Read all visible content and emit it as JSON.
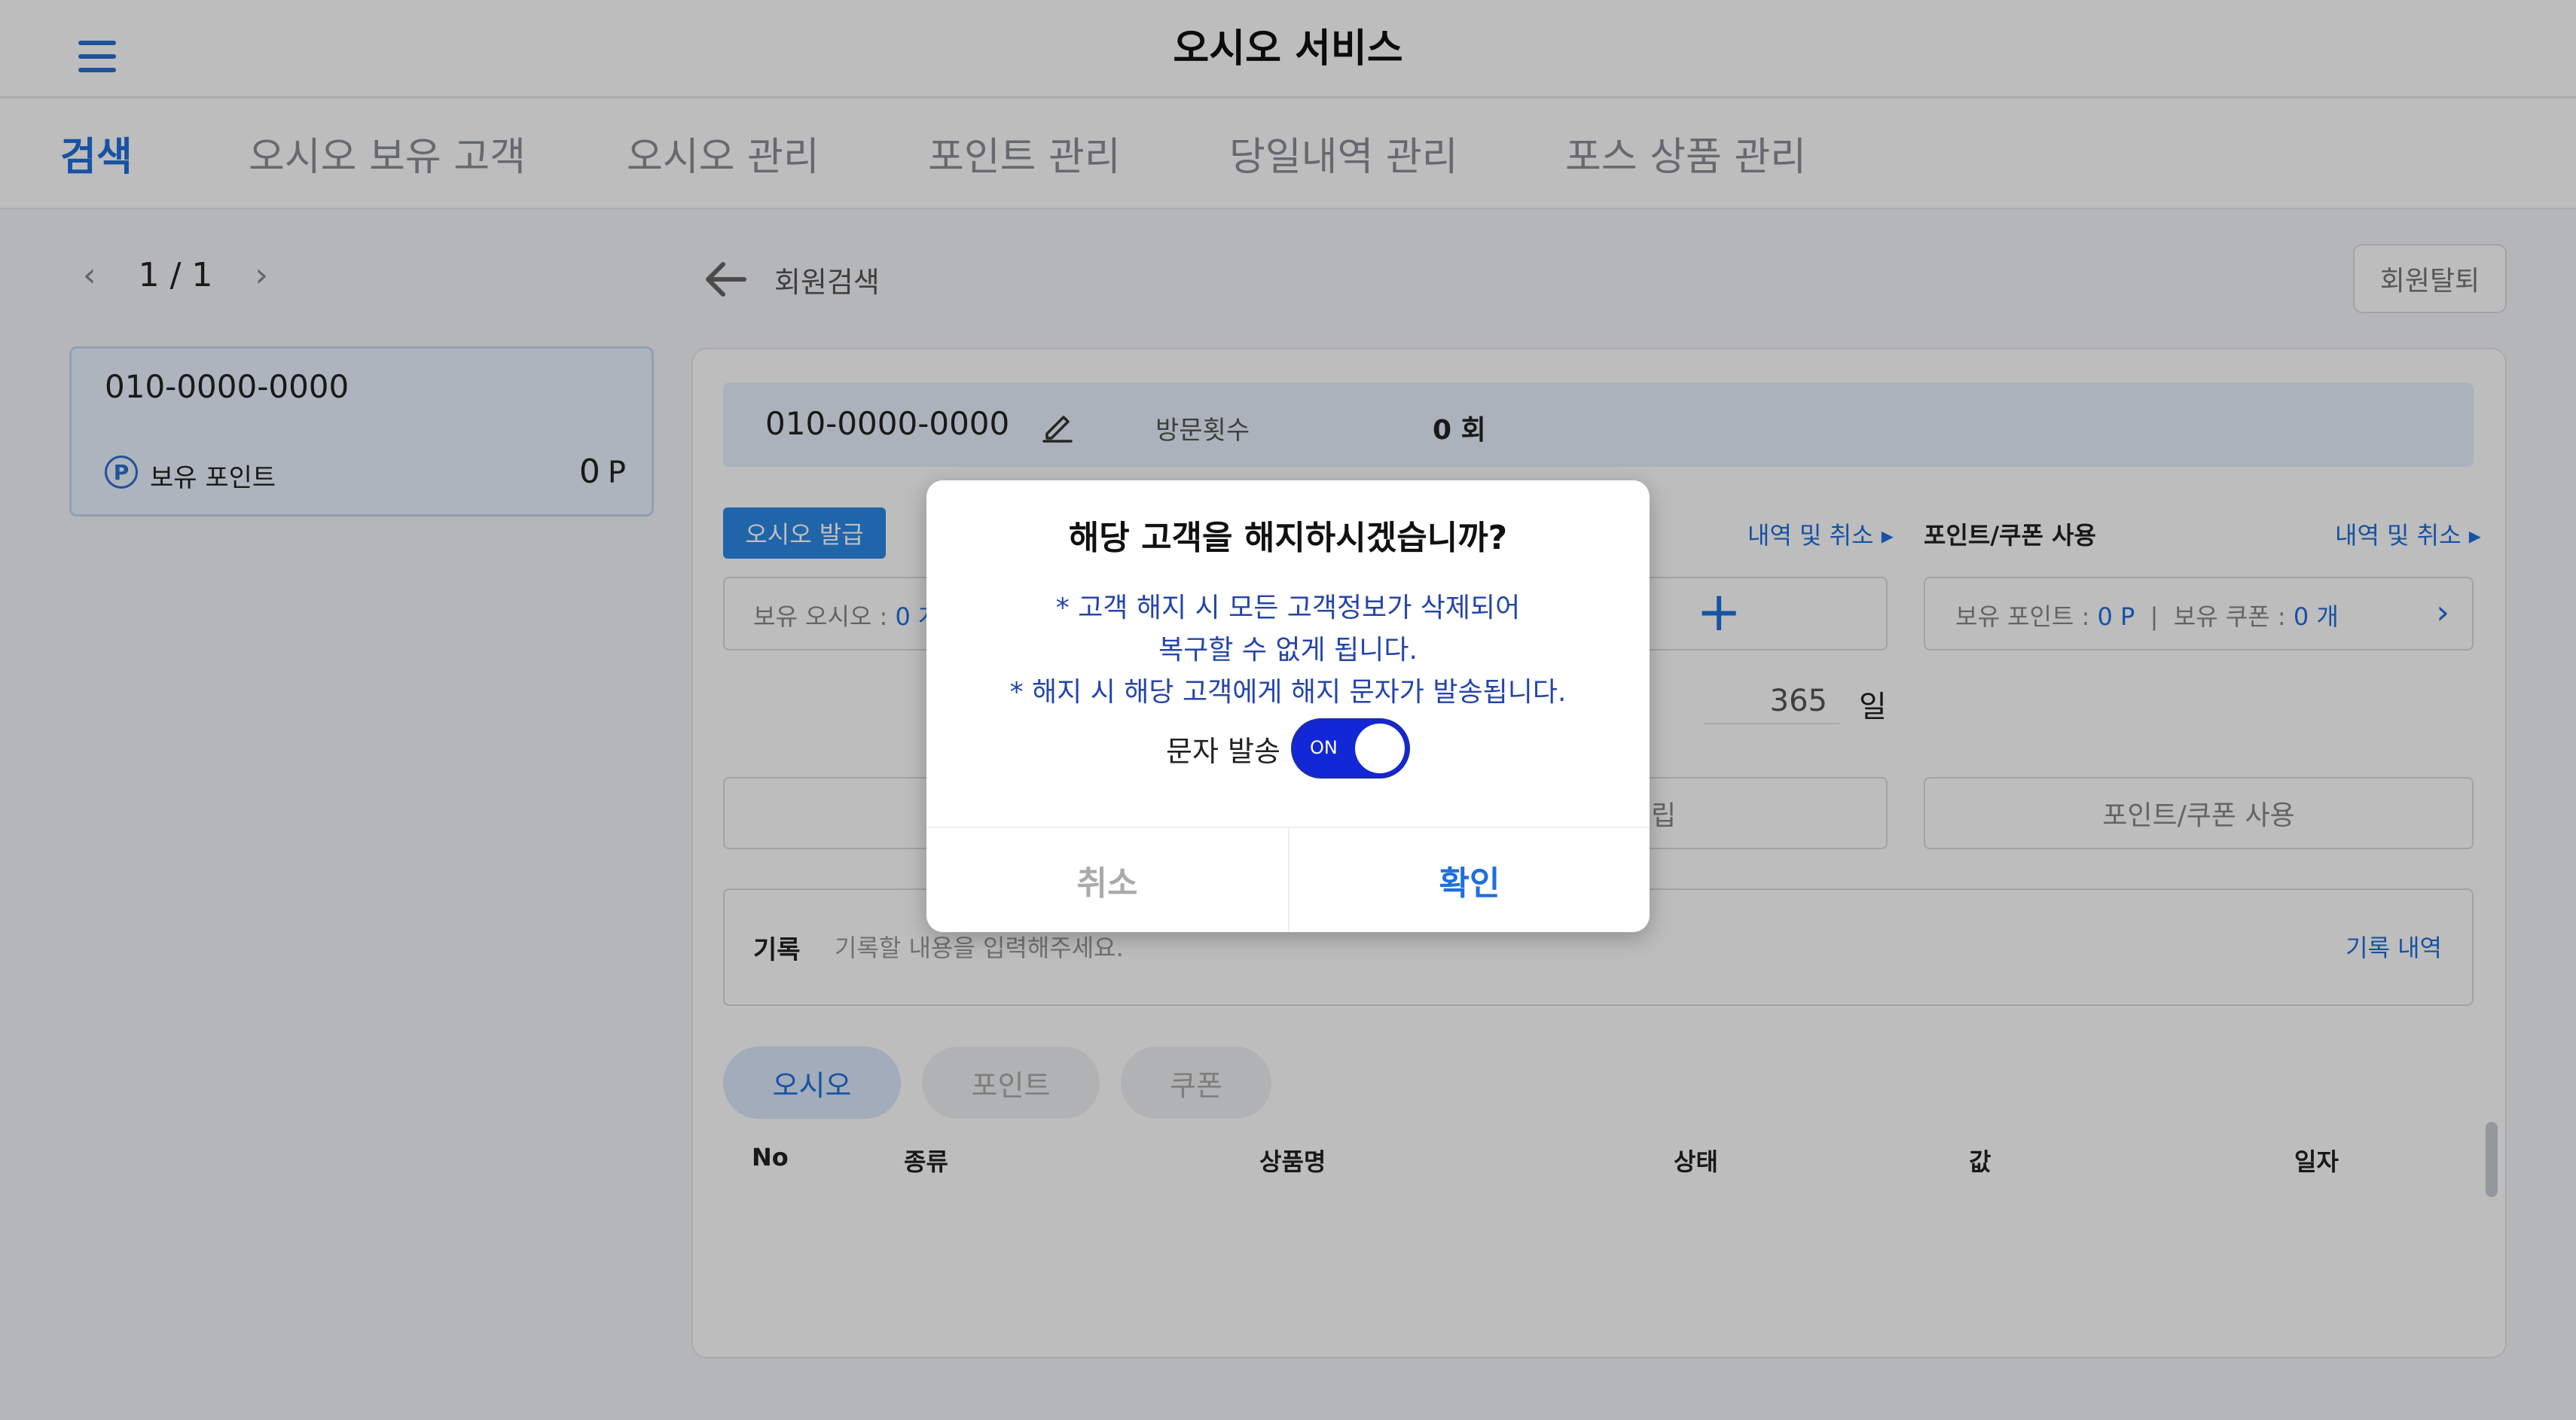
{
  "app": {
    "title": "오시오 서비스"
  },
  "tabs": [
    {
      "label": "검색",
      "active": true
    },
    {
      "label": "오시오 보유 고객",
      "active": false
    },
    {
      "label": "오시오 관리",
      "active": false
    },
    {
      "label": "포인트 관리",
      "active": false
    },
    {
      "label": "당일내역 관리",
      "active": false
    },
    {
      "label": "포스 상품 관리",
      "active": false
    }
  ],
  "pager": {
    "text": "1 / 1"
  },
  "member_card": {
    "phone": "010-0000-0000",
    "points_label": "보유 포인트",
    "points_value": "0",
    "points_unit": "P"
  },
  "detail": {
    "back_label": "회원검색",
    "withdraw_label": "회원탈퇴",
    "phone": "010-0000-0000",
    "visits_label": "방문횟수",
    "visits_value": "0 회",
    "issue_button": "오시오 발급",
    "history_link": "내역 및 취소",
    "point_coupon_section": "포인트/쿠폰 사용",
    "owned_osio_label": "보유 오시오 : ",
    "owned_osio_value": "0 개",
    "owned_points_label": "보유 포인트 : ",
    "owned_points_value": "0 P",
    "owned_coupon_label": "보유 쿠폰 : ",
    "owned_coupon_value": "0 개",
    "days_value": "365",
    "days_unit": "일",
    "left_button_tail": "립",
    "point_coupon_button": "포인트/쿠폰 사용",
    "memo_label": "기록",
    "memo_placeholder": "기록할 내용을 입력해주세요.",
    "memo_history": "기록 내역",
    "sub_tabs": [
      "오시오",
      "포인트",
      "쿠폰"
    ],
    "table_headers": [
      "No",
      "종류",
      "상품명",
      "상태",
      "값",
      "일자"
    ]
  },
  "dialog": {
    "title": "해당 고객을 해지하시겠습니까?",
    "message_lines": [
      "* 고객 해지 시 모든 고객정보가 삭제되어",
      "복구할 수 없게 됩니다.",
      "* 해지 시 해당 고객에게 해지 문자가 발송됩니다."
    ],
    "sms_label": "문자 발송",
    "toggle_text": "ON",
    "cancel": "취소",
    "confirm": "확인"
  },
  "colors": {
    "accent": "#1f6fdc",
    "toggle_on": "#1227d6",
    "message": "#2545a8"
  }
}
